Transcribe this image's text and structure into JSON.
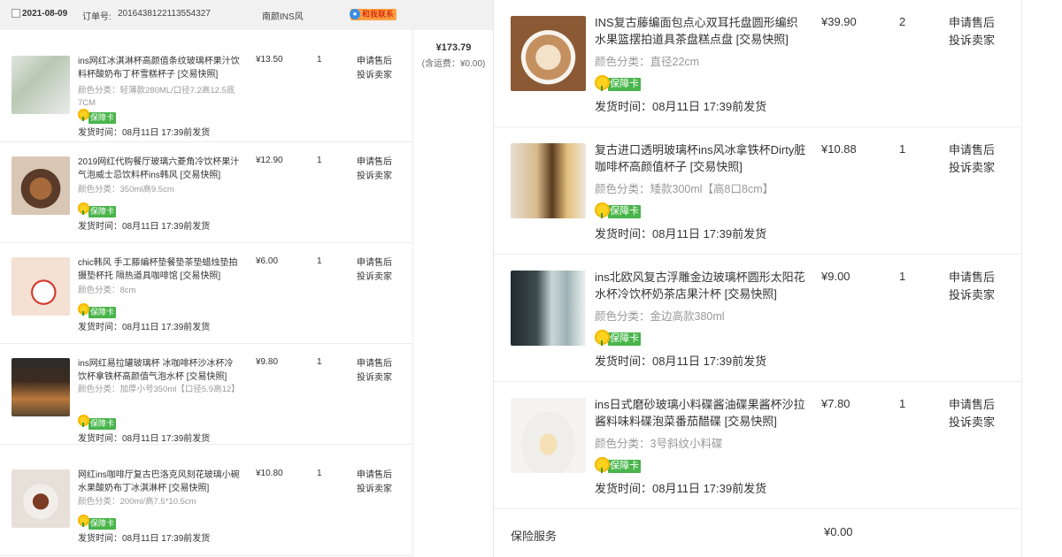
{
  "order": {
    "date": "2021-08-09",
    "order_no_label": "订单号:",
    "order_no": "2016438122113554327",
    "shop": "南颜INS风",
    "contact_label": "和我联系",
    "contact_icon": "chat-bubble-icon",
    "total": "¥173.79",
    "shipping_note": "(含运费：¥0.00)"
  },
  "badge_label": "保障卡",
  "ops": {
    "after_sale": "申请售后",
    "complain": "投诉卖家"
  },
  "left_items": [
    {
      "title": "ins网红冰淇淋杯高颜值条纹玻璃杯果汁饮料杯酸奶布丁杯雪糕杯子 [交易快照]",
      "spec": "颜色分类：轻薄款280ML/口径7.2高12.5底7CM",
      "ship": "发货时间：08月11日 17:39前发货",
      "price": "¥13.50",
      "qty": "1"
    },
    {
      "title": "2019网红代购餐厅玻璃六菱角冷饮杯果汁气泡威士忌饮料杯ins韩风 [交易快照]",
      "spec": "颜色分类：350ml高9.5cm",
      "ship": "发货时间：08月11日 17:39前发货",
      "price": "¥12.90",
      "qty": "1"
    },
    {
      "title": "chic韩风 手工藤编杯垫餐垫茶垫蜡烛垫拍摄垫杯托 隔热道具咖啡馆 [交易快照]",
      "spec": "颜色分类：8cm",
      "ship": "发货时间：08月11日 17:39前发货",
      "price": "¥6.00",
      "qty": "1"
    },
    {
      "title": "ins网红易拉罐玻璃杯 冰咖啡杯沙冰杯冷饮杯拿铁杯高颜值气泡水杯 [交易快照]",
      "spec": "颜色分类：加厚小号350ml【口径5.9高12】",
      "ship": "发货时间：08月11日 17:39前发货",
      "price": "¥9.80",
      "qty": "1"
    },
    {
      "title": "网红ins咖啡厅复古巴洛克风刻花玻璃小碗水果酸奶布丁冰淇淋杯 [交易快照]",
      "spec": "颜色分类：200ml/高7.5*10.5cm",
      "ship": "发货时间：08月11日 17:39前发货",
      "price": "¥10.80",
      "qty": "1"
    }
  ],
  "right_items": [
    {
      "title": "INS复古藤编面包点心双耳托盘圆形编织水果篮摆拍道具茶盘糕点盘 [交易快照]",
      "spec": "颜色分类：直径22cm",
      "ship": "发货时间：08月11日 17:39前发货",
      "price": "¥39.90",
      "qty": "2"
    },
    {
      "title": "复古进口透明玻璃杯ins风冰拿铁杯Dirty脏咖啡杯高颜值杯子 [交易快照]",
      "spec": "颜色分类：矮款300ml【高8口8cm】",
      "ship": "发货时间：08月11日 17:39前发货",
      "price": "¥10.88",
      "qty": "1"
    },
    {
      "title": "ins北欧风复古浮雕金边玻璃杯圆形太阳花水杯冷饮杯奶茶店果汁杯 [交易快照]",
      "spec": "颜色分类：金边高款380ml",
      "ship": "发货时间：08月11日 17:39前发货",
      "price": "¥9.00",
      "qty": "1"
    },
    {
      "title": "ins日式磨砂玻璃小料碟酱油碟果酱杯沙拉酱料味料碟泡菜番茄醋碟 [交易快照]",
      "spec": "颜色分类：3号斜纹小料碟",
      "ship": "发货时间：08月11日 17:39前发货",
      "price": "¥7.80",
      "qty": "1"
    }
  ],
  "insurance": {
    "label": "保险服务",
    "value": "¥0.00"
  }
}
